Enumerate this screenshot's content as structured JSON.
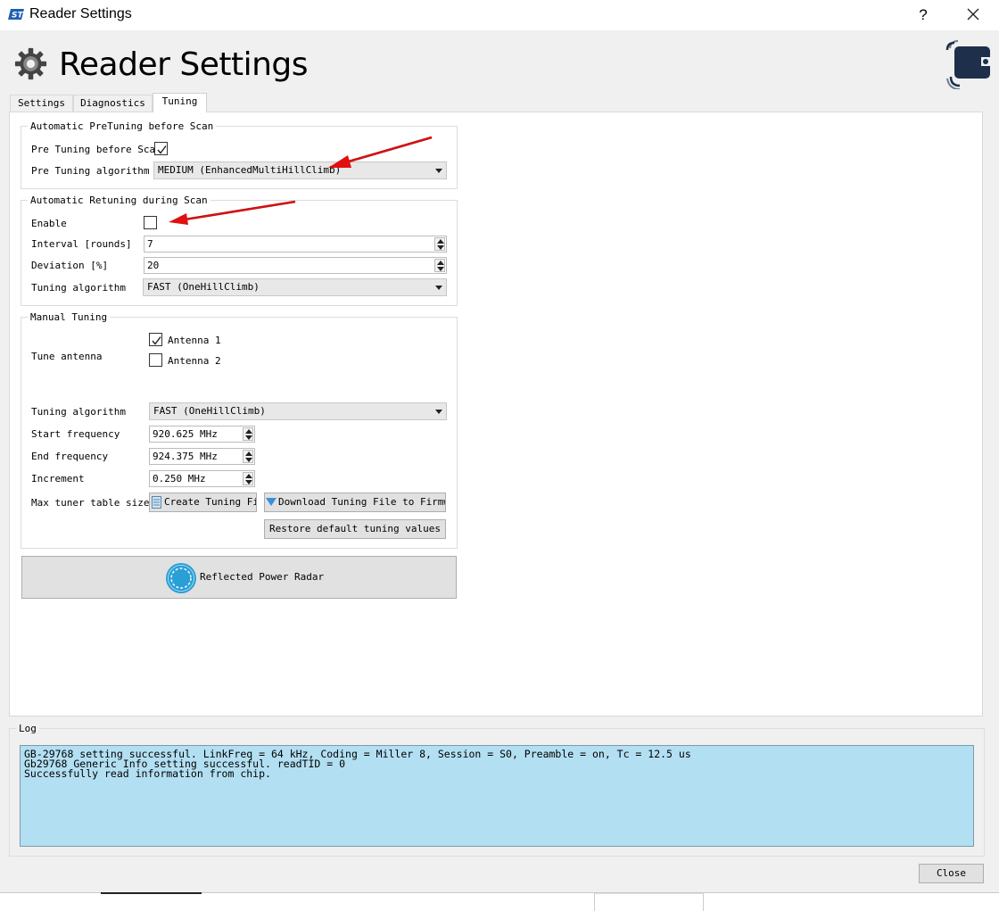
{
  "window": {
    "title": "Reader Settings",
    "help_label": "?"
  },
  "header": {
    "title": "Reader Settings"
  },
  "tabs": [
    {
      "label": "Settings",
      "active": false
    },
    {
      "label": "Diagnostics",
      "active": false
    },
    {
      "label": "Tuning",
      "active": true
    }
  ],
  "pretuning": {
    "group_title": "Automatic PreTuning before Scan",
    "enable_label": "Pre Tuning before Scan",
    "enabled": true,
    "algorithm_label": "Pre Tuning algorithm",
    "algorithm_value": "MEDIUM (EnhancedMultiHillClimb)"
  },
  "retuning": {
    "group_title": "Automatic Retuning during Scan",
    "enable_label": "Enable",
    "enabled": false,
    "interval_label": "Interval [rounds]",
    "interval_value": "7",
    "deviation_label": "Deviation [%]",
    "deviation_value": "20",
    "algorithm_label": "Tuning algorithm",
    "algorithm_value": "FAST (OneHillClimb)"
  },
  "manual": {
    "group_title": "Manual Tuning",
    "tune_antenna_label": "Tune antenna",
    "antenna1_label": "Antenna 1",
    "antenna1_checked": true,
    "antenna2_label": "Antenna 2",
    "antenna2_checked": false,
    "algorithm_label": "Tuning algorithm",
    "algorithm_value": "FAST (OneHillClimb)",
    "start_freq_label": "Start frequency",
    "start_freq_value": "920.625 MHz",
    "end_freq_label": "End frequency",
    "end_freq_value": "924.375 MHz",
    "increment_label": "Increment",
    "increment_value": "0.250 MHz",
    "max_table_label": "Max tuner table size",
    "create_button": "Create Tuning Fil",
    "download_button": "Download Tuning File to Firmwar",
    "restore_button": "Restore default tuning values"
  },
  "radar_button": "Reflected Power Radar",
  "log": {
    "title": "Log",
    "lines": "GB-29768 setting successful. LinkFreq = 64 kHz, Coding = Miller 8, Session = S0, Preamble = on, Tc = 12.5 us\nGb29768 Generic Info setting successful. readTID = 0\nSuccessfully read information from chip."
  },
  "close_button": "Close",
  "colors": {
    "log_background": "#b3dff2",
    "annotation_arrow": "#e01010",
    "radar_icon": "#2a9fd6"
  }
}
